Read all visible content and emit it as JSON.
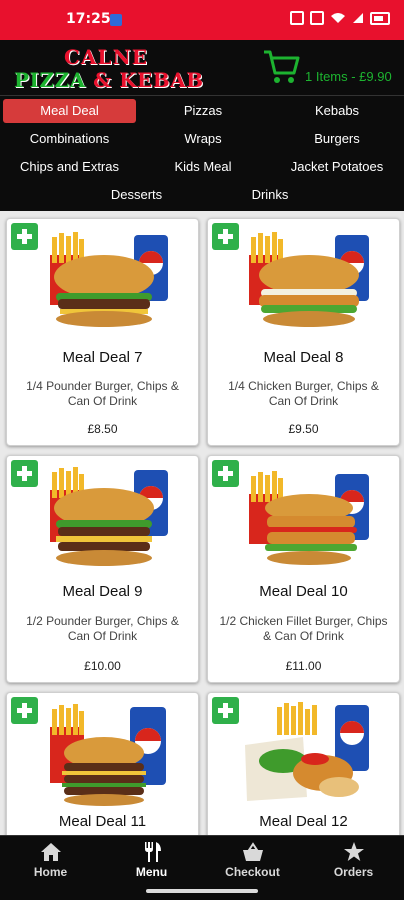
{
  "status_bar": {
    "time": "17:25"
  },
  "header": {
    "logo_line1": "CALNE",
    "logo_line2_a": "PIZZA",
    "logo_line2_amp": "&",
    "logo_line2_b": "KEBAB",
    "cart_summary": "1 Items - £9.90"
  },
  "categories": [
    "Meal Deal",
    "Pizzas",
    "Kebabs",
    "Combinations",
    "Wraps",
    "Burgers",
    "Chips and Extras",
    "Kids Meal",
    "Jacket Potatoes",
    "Desserts",
    "Drinks"
  ],
  "active_category": "Meal Deal",
  "products": [
    {
      "name": "Meal Deal 7",
      "description": "1/4 Pounder Burger, Chips & Can Of Drink",
      "price": "£8.50",
      "image": "burger-chips-can"
    },
    {
      "name": "Meal Deal 8",
      "description": "1/4 Chicken Burger, Chips & Can Of Drink",
      "price": "£9.50",
      "image": "chicken-burger-chips-can"
    },
    {
      "name": "Meal Deal 9",
      "description": "1/2 Pounder Burger, Chips & Can Of Drink",
      "price": "£10.00",
      "image": "double-burger-chips-can"
    },
    {
      "name": "Meal Deal 10",
      "description": "1/2 Chicken Fillet Burger, Chips & Can Of Drink",
      "price": "£11.00",
      "image": "chicken-fillet-burger-chips-can"
    },
    {
      "name": "Meal Deal 11",
      "description": "",
      "price": "",
      "image": "triple-burger-chips-can"
    },
    {
      "name": "Meal Deal 12",
      "description": "",
      "price": "",
      "image": "wrap-chips-can"
    }
  ],
  "bottom_nav": [
    {
      "label": "Home",
      "icon": "home-icon"
    },
    {
      "label": "Menu",
      "icon": "cutlery-icon"
    },
    {
      "label": "Checkout",
      "icon": "basket-icon"
    },
    {
      "label": "Orders",
      "icon": "star-icon"
    }
  ],
  "active_tab": "Menu",
  "colors": {
    "status_red": "#e8112d",
    "brand_green": "#1db330",
    "active_red": "#d63b3b",
    "add_green": "#2fb04a",
    "dark": "#0c0c0c"
  }
}
